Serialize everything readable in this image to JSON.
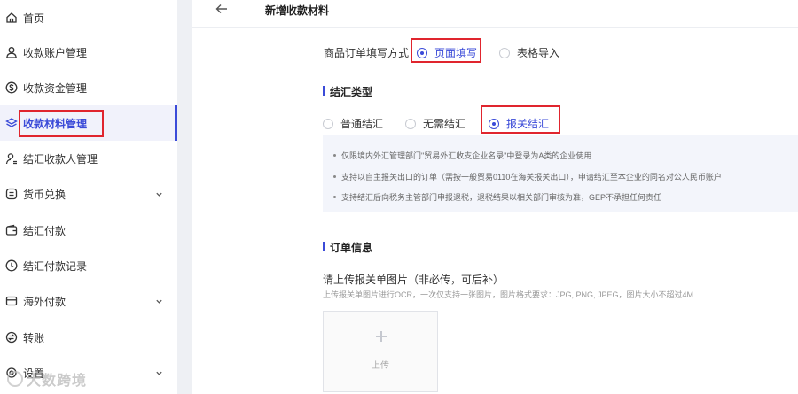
{
  "sidebar": {
    "items": [
      {
        "label": "首页",
        "icon": "home-icon",
        "expandable": false,
        "active": false
      },
      {
        "label": "收款账户管理",
        "icon": "user-icon",
        "expandable": false,
        "active": false
      },
      {
        "label": "收款资金管理",
        "icon": "dollar-circle-icon",
        "expandable": false,
        "active": false
      },
      {
        "label": "收款材料管理",
        "icon": "layers-icon",
        "expandable": false,
        "active": true
      },
      {
        "label": "结汇收款人管理",
        "icon": "user-settings-icon",
        "expandable": false,
        "active": false
      },
      {
        "label": "货币兑换",
        "icon": "exchange-icon",
        "expandable": true,
        "active": false
      },
      {
        "label": "结汇付款",
        "icon": "wallet-icon",
        "expandable": false,
        "active": false
      },
      {
        "label": "结汇付款记录",
        "icon": "clock-icon",
        "expandable": false,
        "active": false
      },
      {
        "label": "海外付款",
        "icon": "card-icon",
        "expandable": true,
        "active": false
      },
      {
        "label": "转账",
        "icon": "transfer-icon",
        "expandable": false,
        "active": false
      },
      {
        "label": "设置",
        "icon": "gear-icon",
        "expandable": true,
        "active": false
      }
    ],
    "watermark": "大数跨境"
  },
  "header": {
    "title": "新增收款材料"
  },
  "form": {
    "fill_method": {
      "label": "商品订单填写方式",
      "options": [
        "页面填写",
        "表格导入"
      ],
      "selected": "页面填写"
    },
    "settlement": {
      "section_title": "结汇类型",
      "options": [
        "普通结汇",
        "无需结汇",
        "报关结汇"
      ],
      "selected": "报关结汇",
      "notes": [
        "仅限境内外汇管理部门\"贸易外汇收支企业名录\"中登录为A类的企业使用",
        "支持以自主报关出口的订单（需按一般贸易0110在海关报关出口），申请结汇至本企业的同名对公人民币账户",
        "支持结汇后向税务主管部门申报退税，退税结果以相关部门审核为准，GEP不承担任何责任"
      ]
    },
    "order_info": {
      "section_title": "订单信息",
      "upload_title": "请上传报关单图片（非必传，可后补）",
      "upload_hint": "上传报关单图片进行OCR，一次仅支持一张图片，图片格式要求：JPG, PNG, JPEG，图片大小不超过4M",
      "upload_button": "上传"
    }
  },
  "colors": {
    "accent": "#3b4bd8",
    "highlight_box": "#e0252e"
  }
}
